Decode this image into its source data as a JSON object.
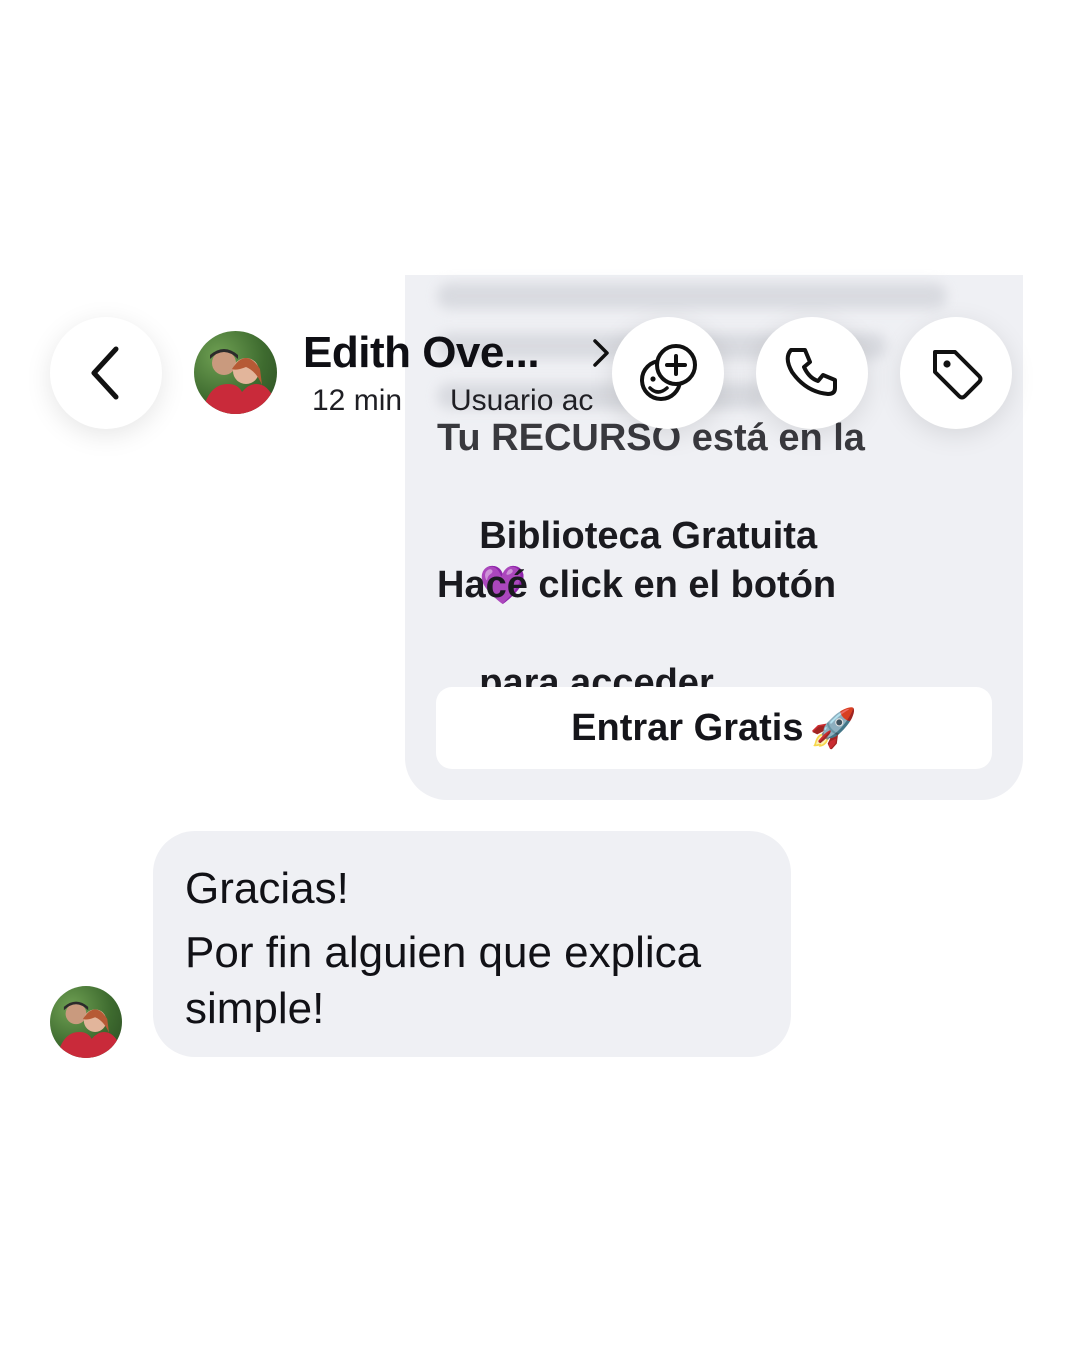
{
  "header": {
    "contact_name": "Edith Ove...",
    "time_ago": "12 min",
    "status": "Usuario ac"
  },
  "outgoing_card": {
    "line1": "Tu RECURSO está en la",
    "line2_text": "Biblioteca Gratuita",
    "line2_emoji": "💜",
    "line3": "Hacé click en el botón",
    "line4_text": "para acceder",
    "line4_emoji": "👇",
    "button_label": "Entrar Gratis",
    "button_emoji": "🚀"
  },
  "incoming_message": {
    "lines": [
      "Gracias!",
      "Por fin alguien que explica",
      "simple!"
    ]
  },
  "colors": {
    "bubble": "#eff0f4",
    "background": "#ffffff",
    "text": "#0f0f14"
  },
  "icons": [
    "back-chevron-icon",
    "chevron-right-icon",
    "add-sticker-icon",
    "phone-icon",
    "tag-icon"
  ]
}
